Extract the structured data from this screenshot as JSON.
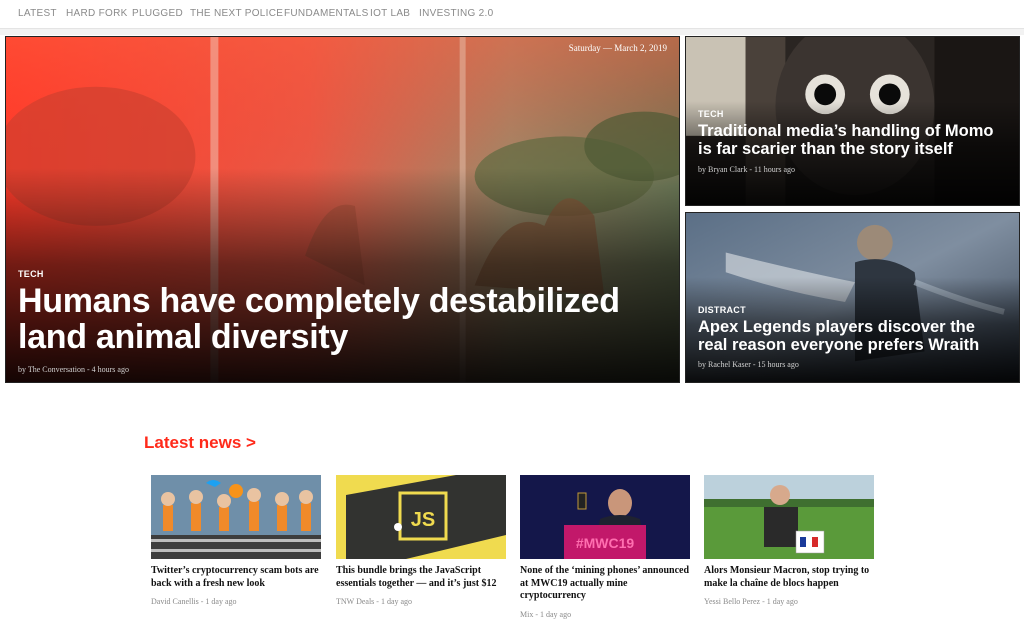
{
  "nav": {
    "items": [
      "LATEST",
      "HARD FORK",
      "PLUGGED",
      "THE NEXT POLICE",
      "FUNDAMENTALS",
      "IOT LAB",
      "INVESTING 2.0"
    ]
  },
  "hero": {
    "date": "Saturday — March 2, 2019",
    "main": {
      "category": "TECH",
      "headline": "Humans have completely destabilized land animal diversity",
      "byline": "by The Conversation - 4 hours ago"
    },
    "side": [
      {
        "category": "TECH",
        "headline": "Traditional media’s handling of Momo is far scarier than the story itself",
        "byline": "by Bryan Clark - 11 hours ago"
      },
      {
        "category": "DISTRACT",
        "headline": "Apex Legends players discover the real reason everyone prefers Wraith",
        "byline": "by Rachel Kaser - 15 hours ago"
      }
    ]
  },
  "latest": {
    "heading": "Latest news >",
    "accent": "#ff2a1a",
    "items": [
      {
        "title": "Twitter’s cryptocurrency scam bots are back with a fresh new look",
        "byline": "David Canellis - 1 day ago"
      },
      {
        "title": "This bundle brings the JavaScript essentials together — and it’s just $12",
        "byline": "TNW Deals - 1 day ago",
        "image_text": "JS"
      },
      {
        "title": "None of the ‘mining phones’ announced at MWC19 actually mine cryptocurrency",
        "byline": "Mix - 1 day ago",
        "image_text": "#MWC19"
      },
      {
        "title": "Alors Monsieur Macron, stop trying to make la chaîne de blocs happen",
        "byline": "Yessi Bello Perez - 1 day ago"
      }
    ]
  }
}
